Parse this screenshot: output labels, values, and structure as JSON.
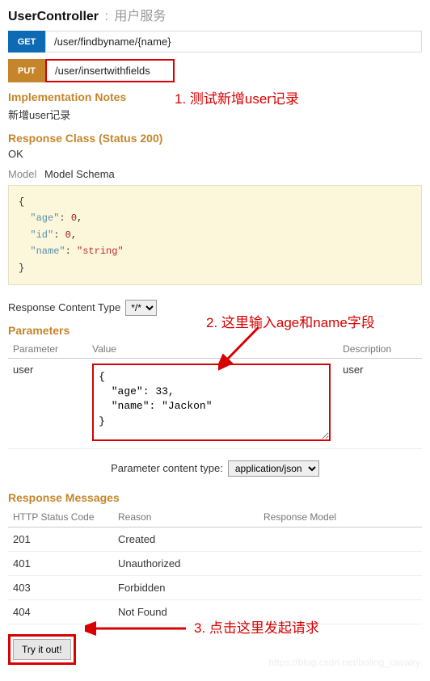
{
  "controller": {
    "name": "UserController",
    "desc": "用户服务"
  },
  "operations": {
    "get": {
      "method": "GET",
      "path": "/user/findbyname/{name}"
    },
    "put": {
      "method": "PUT",
      "path": "/user/insertwithfields"
    }
  },
  "impl_notes": {
    "title": "Implementation Notes",
    "text": "新增user记录"
  },
  "response_class": {
    "title": "Response Class (Status 200)",
    "ok": "OK"
  },
  "tabs": {
    "model": "Model",
    "schema": "Model Schema"
  },
  "schema": {
    "open": "{",
    "line1_key": "\"age\"",
    "line1_sep": ": ",
    "line1_val": "0",
    "line1_comma": ",",
    "line2_key": "\"id\"",
    "line2_val": "0",
    "line3_key": "\"name\"",
    "line3_val": "\"string\"",
    "close": "}"
  },
  "rct": {
    "label": "Response Content Type",
    "option": "*/*"
  },
  "parameters": {
    "title": "Parameters",
    "headers": {
      "param": "Parameter",
      "value": "Value",
      "desc": "Description"
    },
    "row": {
      "name": "user",
      "value": "{\n  \"age\": 33,\n  \"name\": \"Jackon\"\n}",
      "desc": "user"
    }
  },
  "pct": {
    "label": "Parameter content type:",
    "option": "application/json"
  },
  "resp_msgs": {
    "title": "Response Messages",
    "headers": {
      "code": "HTTP Status Code",
      "reason": "Reason",
      "model": "Response Model"
    },
    "rows": [
      {
        "code": "201",
        "reason": "Created"
      },
      {
        "code": "401",
        "reason": "Unauthorized"
      },
      {
        "code": "403",
        "reason": "Forbidden"
      },
      {
        "code": "404",
        "reason": "Not Found"
      }
    ]
  },
  "try": {
    "label": "Try it out!"
  },
  "annotations": {
    "a1": "1. 测试新增user记录",
    "a2": "2. 这里输入age和name字段",
    "a3": "3. 点击这里发起请求"
  },
  "watermark": "https://blog.csdn.net/boling_cavalry"
}
